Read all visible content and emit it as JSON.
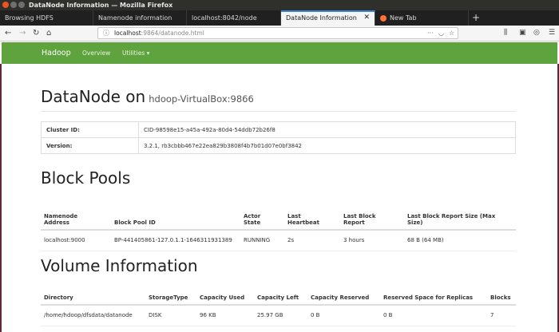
{
  "window": {
    "title": "DataNode Information — Mozilla Firefox"
  },
  "tabs": [
    {
      "label": "Browsing HDFS"
    },
    {
      "label": "Namenode information"
    },
    {
      "label": "localhost:8042/node"
    },
    {
      "label": "DataNode Information"
    },
    {
      "label": "New Tab"
    }
  ],
  "address": {
    "host": "localhost",
    "rest": ":9864/datanode.html"
  },
  "hadoop_nav": {
    "brand": "Hadoop",
    "overview": "Overview",
    "utilities": "Utilities ▾"
  },
  "page": {
    "heading": "DataNode on",
    "host": "hdoop-VirtualBox:9866",
    "cluster_id_label": "Cluster ID:",
    "cluster_id": "CID-98598e15-a45a-492a-80d4-54ddb72b26f8",
    "version_label": "Version:",
    "version": "3.2.1, rb3cbbb467e22ea829b3808f4b7b01d07e0bf3842"
  },
  "block_pools": {
    "title": "Block Pools",
    "headers": {
      "namenode": [
        "Namenode",
        "Address"
      ],
      "pool": "Block Pool ID",
      "actor": [
        "Actor",
        "State"
      ],
      "heartbeat": [
        "Last",
        "Heartbeat"
      ],
      "report": [
        "Last Block",
        "Report"
      ],
      "size": [
        "Last Block Report Size (Max",
        "Size)"
      ]
    },
    "row": {
      "namenode": "localhost:9000",
      "pool": "BP-441405861-127.0.1.1-1646311931389",
      "actor": "RUNNING",
      "heartbeat": "2s",
      "report": "3 hours",
      "size": "68 B (64 MB)"
    }
  },
  "volume": {
    "title": "Volume Information",
    "headers": {
      "directory": "Directory",
      "storage": "StorageType",
      "used": "Capacity Used",
      "left": "Capacity Left",
      "reserved": "Capacity Reserved",
      "replicas": "Reserved Space for Replicas",
      "blocks": "Blocks"
    },
    "row": {
      "directory": "/home/hdoop/dfsdata/datanode",
      "storage": "DISK",
      "used": "96 KB",
      "left": "25.97 GB",
      "reserved": "0 B",
      "replicas": "0 B",
      "blocks": "7"
    }
  },
  "colors": {
    "hadoop_green": "#5fa33e",
    "active_tab_accent": "#3b86d9"
  }
}
